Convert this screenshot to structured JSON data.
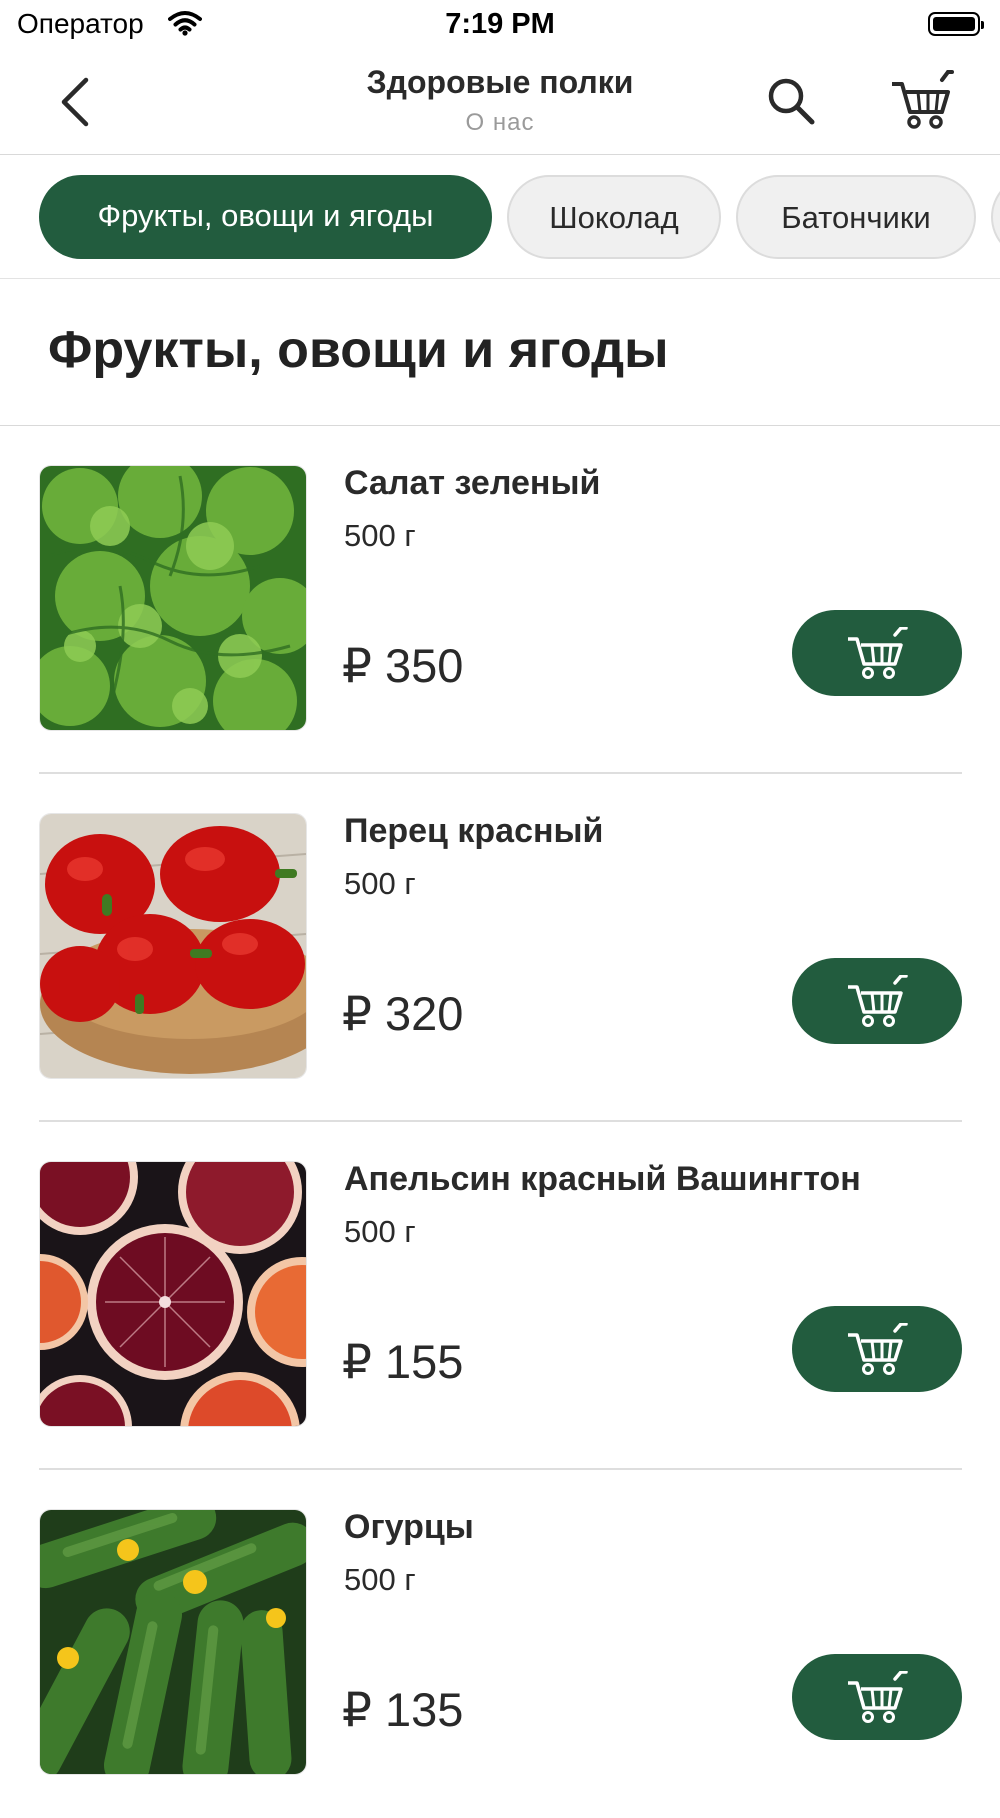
{
  "status_bar": {
    "carrier": "Оператор",
    "time": "7:19 PM"
  },
  "nav": {
    "title": "Здоровые полки",
    "subtitle": "О нас"
  },
  "categories": [
    {
      "label": "Фрукты, овощи и ягоды",
      "selected": true
    },
    {
      "label": "Шоколад",
      "selected": false
    },
    {
      "label": "Батончики",
      "selected": false
    }
  ],
  "section_title": "Фрукты, овощи и ягоды",
  "products": [
    {
      "name": "Салат зеленый",
      "weight": "500 г",
      "price": "₽ 350",
      "image": "lettuce"
    },
    {
      "name": "Перец красный",
      "weight": "500 г",
      "price": "₽ 320",
      "image": "red-peppers"
    },
    {
      "name": "Апельсин красный Вашингтон",
      "weight": "500 г",
      "price": "₽ 155",
      "image": "blood-oranges"
    },
    {
      "name": "Огурцы",
      "weight": "500 г",
      "price": "₽ 135",
      "image": "cucumbers"
    }
  ],
  "colors": {
    "accent": "#225c3e",
    "chip_inactive": "#f0f0f0",
    "text": "#2a2a2a",
    "muted": "#9a9a9a"
  }
}
